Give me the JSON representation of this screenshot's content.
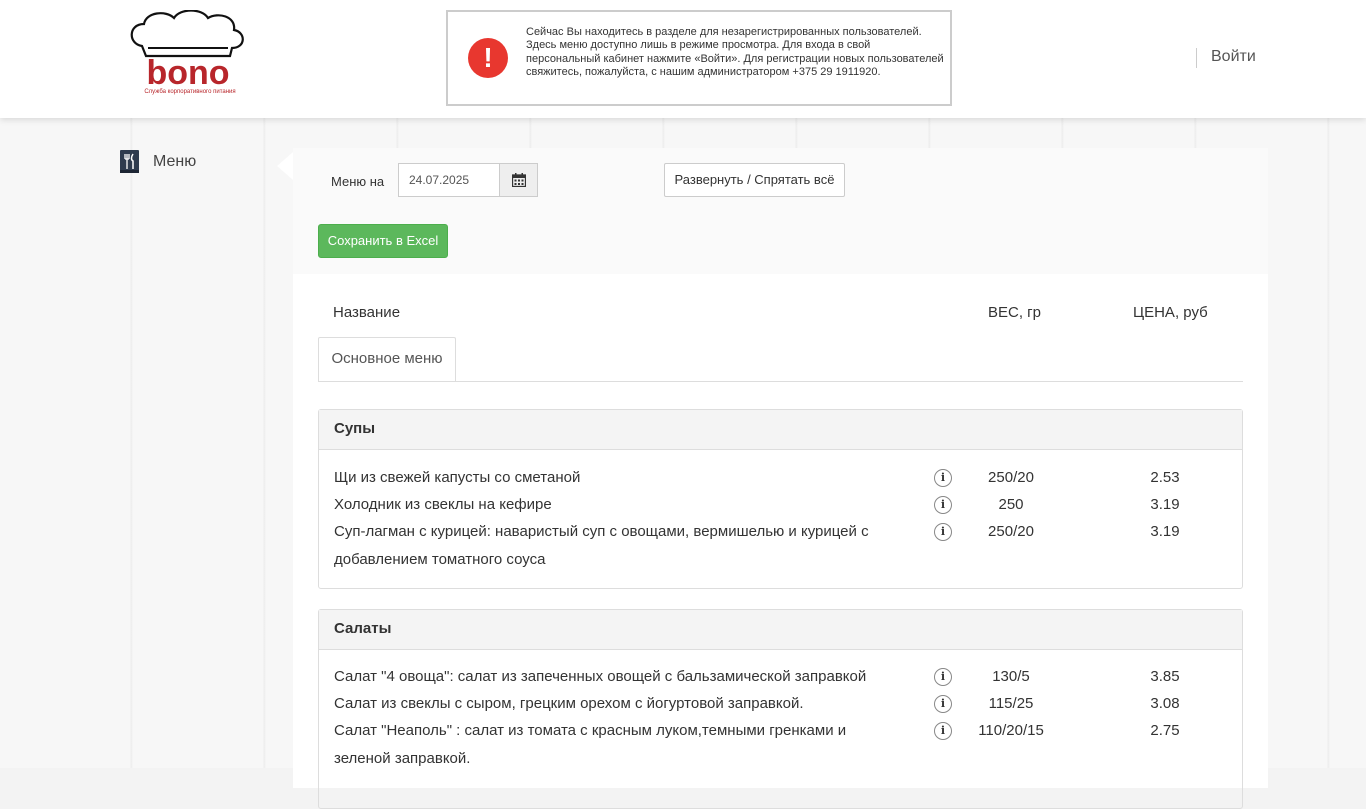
{
  "header": {
    "logo_text": "bono",
    "logo_subtitle": "Служба корпоративного питания",
    "notice_text": "Сейчас Вы находитесь в разделе для незарегистрированных пользователей. Здесь меню доступно лишь в режиме просмотра. Для входа в свой персональный кабинет нажмите «Войти». Для регистрации новых пользователей свяжитесь, пожалуйста, с нашим администратором +375 29 1911920.",
    "notice_icon": "!",
    "login_label": "Войти"
  },
  "sidebar": {
    "items": [
      {
        "label": "Меню",
        "icon": "menu-book-icon"
      }
    ]
  },
  "toolbar": {
    "date_label": "Меню на",
    "date_value": "24.07.2025",
    "expand_label": "Развернуть / Спрятать всё",
    "excel_label": "Сохранить в Excel"
  },
  "table": {
    "col_name": "Название",
    "col_weight": "ВЕС, гр",
    "col_price": "ЦЕНА, руб",
    "tab_label": "Основное меню"
  },
  "categories": [
    {
      "name": "Супы",
      "items": [
        {
          "name": "Щи из свежей капусты со сметаной",
          "weight": "250/20",
          "price": "2.53"
        },
        {
          "name": "Холодник из свеклы на кефире",
          "weight": "250",
          "price": "3.19"
        },
        {
          "name": "Суп-лагман с курицей: наваристый суп с овощами, вермишелью и курицей с добавлением томатного соуса",
          "weight": "250/20",
          "price": "3.19"
        }
      ]
    },
    {
      "name": "Салаты",
      "items": [
        {
          "name": "Салат \"4 овоща\": салат из запеченных овощей с бальзамической заправкой",
          "weight": "130/5",
          "price": "3.85"
        },
        {
          "name": "Салат из свеклы с сыром, грецким орехом с йогуртовой заправкой.",
          "weight": "115/25",
          "price": "3.08"
        },
        {
          "name": "Салат \"Неаполь\" : салат из томата с красным луком,темными гренками и зеленой заправкой.",
          "weight": "110/20/15",
          "price": "2.75"
        }
      ]
    }
  ],
  "info_icon_glyph": "i",
  "colors": {
    "brand_red": "#b8262b",
    "alert_red": "#e8372f",
    "excel_green": "#5cb85c"
  }
}
